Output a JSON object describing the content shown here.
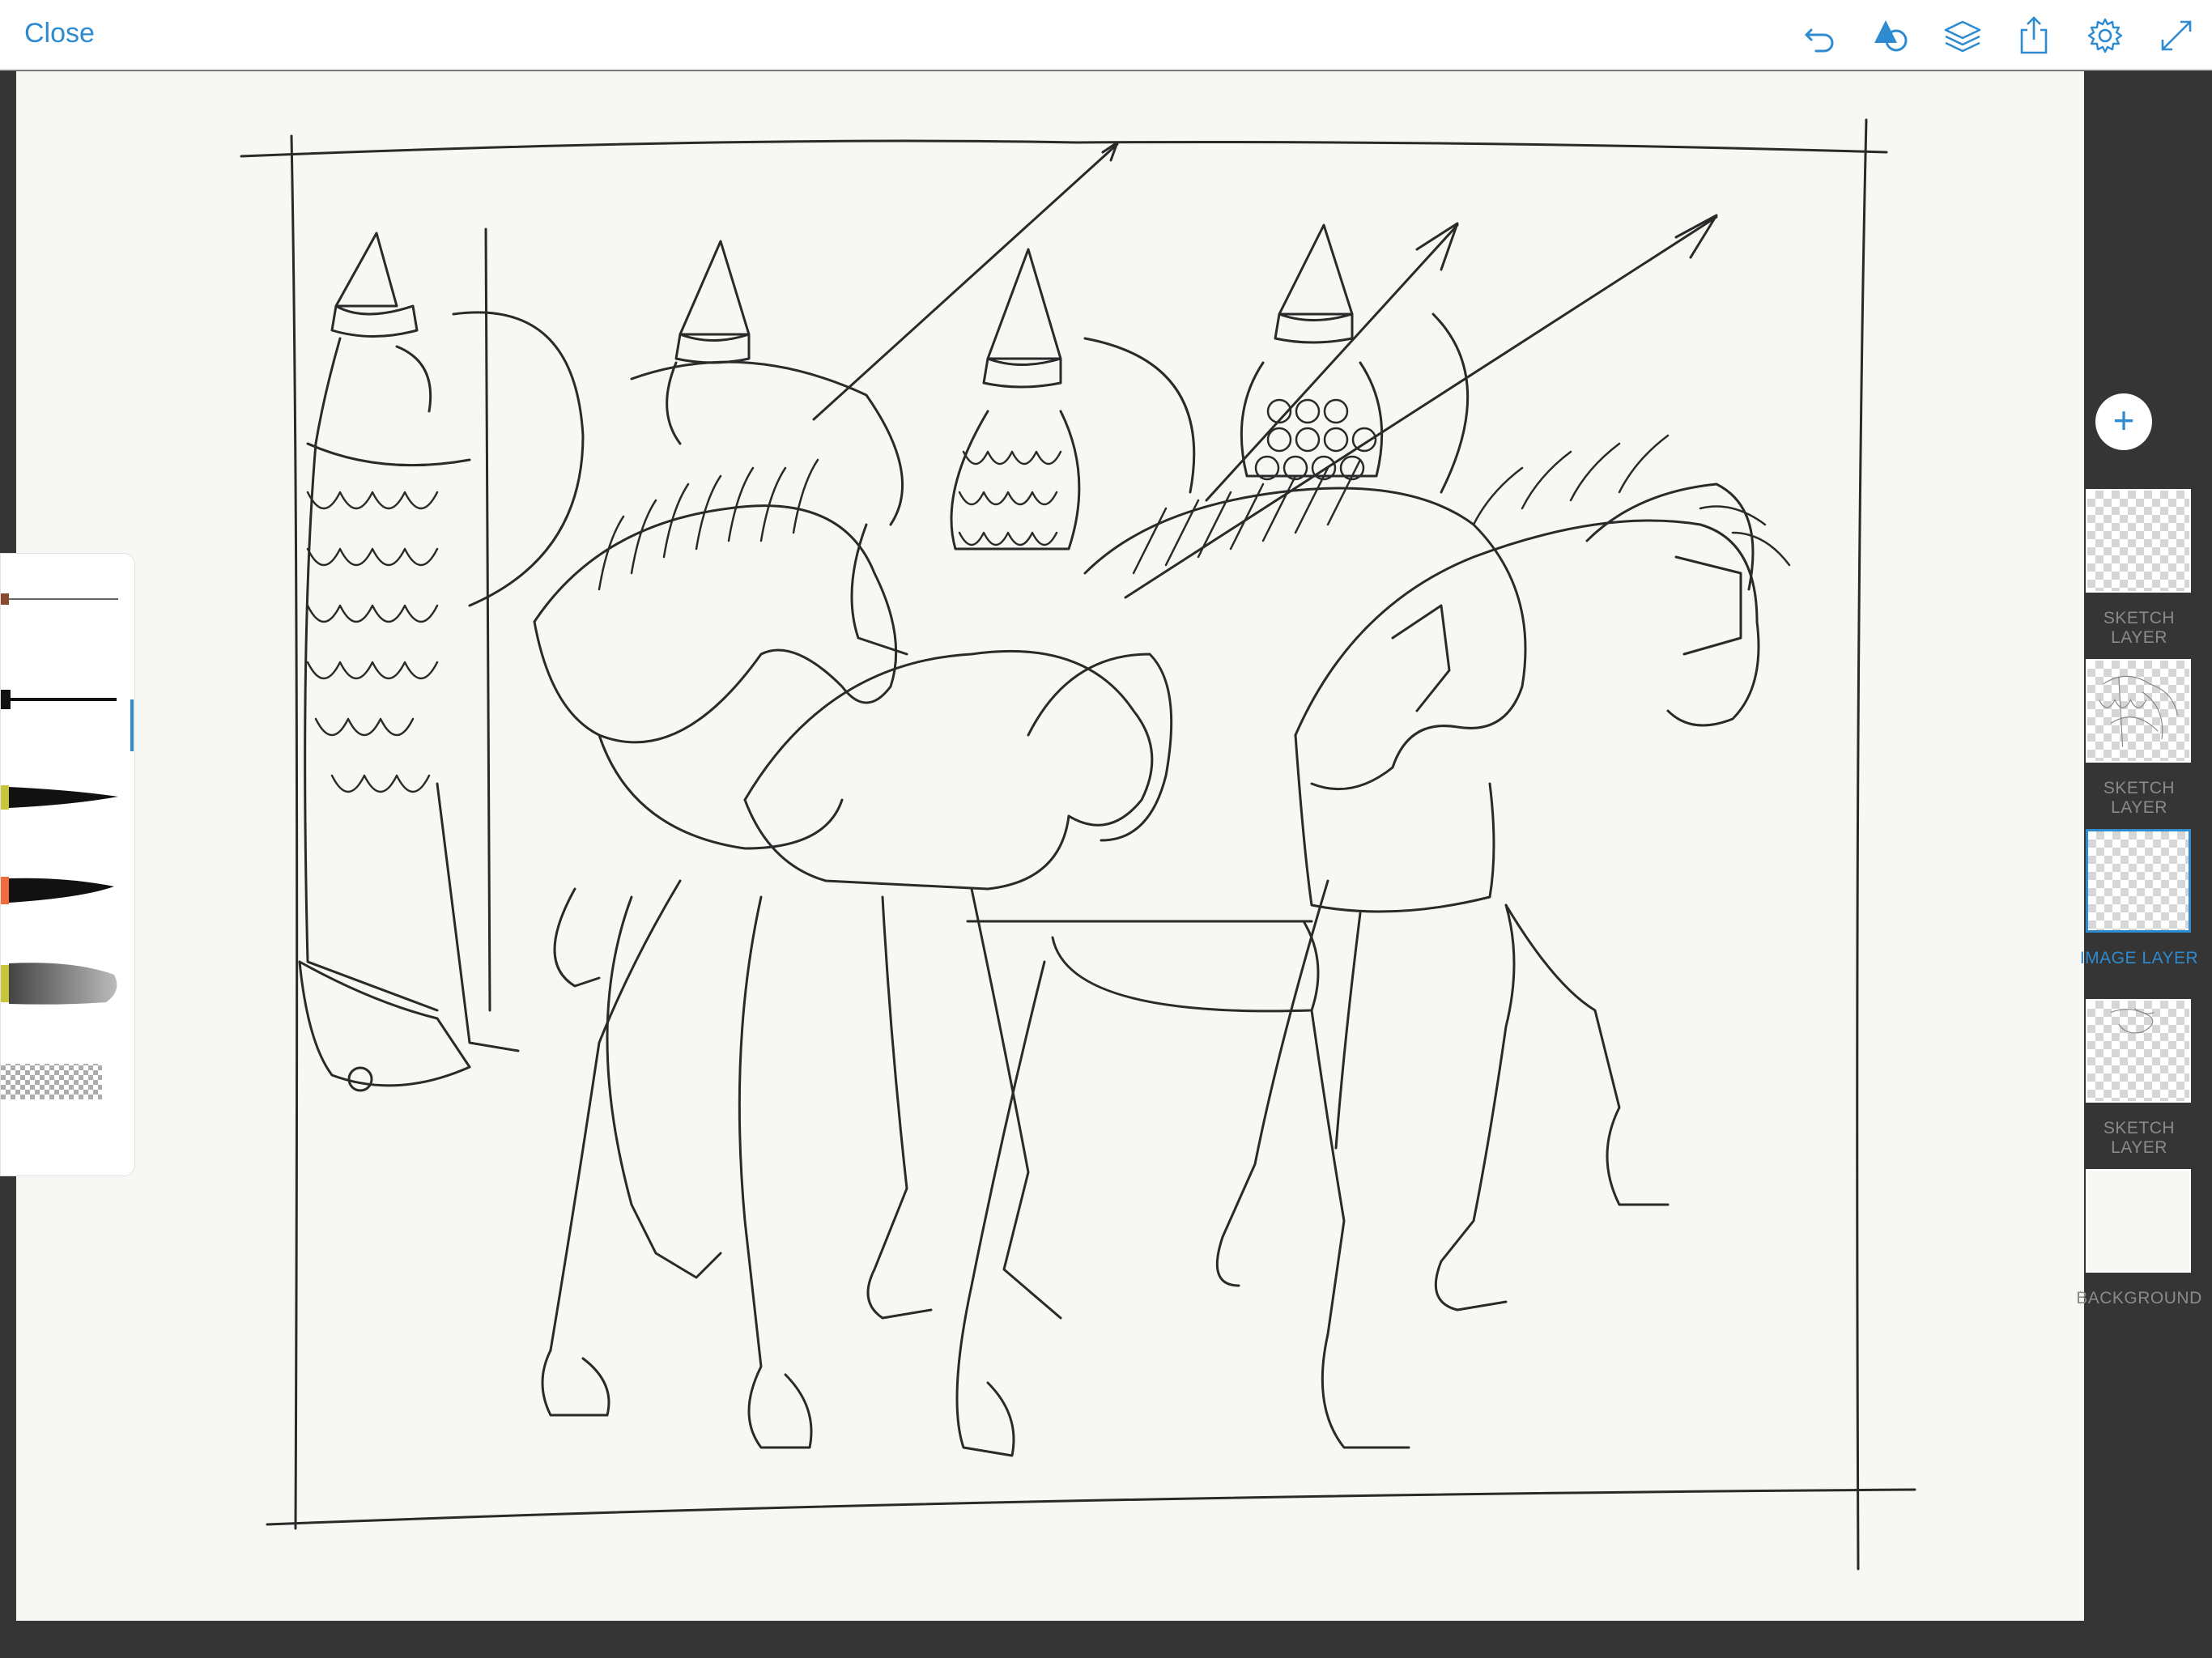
{
  "toolbar": {
    "close_label": "Close",
    "icons": [
      "undo-icon",
      "shape-icon",
      "layers-icon",
      "share-icon",
      "settings-icon",
      "fullscreen-icon"
    ]
  },
  "accent_color": "#2f8bd0",
  "brushes": [
    {
      "name": "fine-pen-brush",
      "tip_color": "#8b4a2f"
    },
    {
      "name": "round-pen-brush",
      "tip_color": "#111111",
      "selected": true
    },
    {
      "name": "ink-brush",
      "tip_color": "#c9c53a"
    },
    {
      "name": "paint-brush",
      "tip_color": "#f06a3c"
    },
    {
      "name": "watercolor-brush",
      "tip_color": "#c9c53a"
    },
    {
      "name": "eraser-brush",
      "tip_color": "#bbbbbb"
    }
  ],
  "layers": [
    {
      "label": "SKETCH LAYER",
      "selected": false
    },
    {
      "label": "SKETCH LAYER",
      "selected": false
    },
    {
      "label": "IMAGE LAYER",
      "selected": true
    },
    {
      "label": "SKETCH LAYER",
      "selected": false
    },
    {
      "label": "BACKGROUND",
      "selected": false
    }
  ]
}
